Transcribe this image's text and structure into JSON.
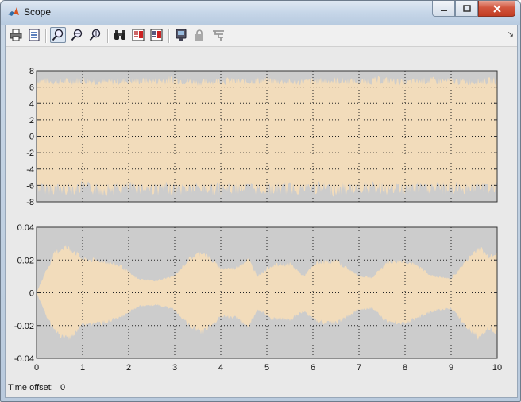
{
  "window": {
    "title": "Scope"
  },
  "toolbar": {
    "buttons": [
      {
        "icon": "print-icon"
      },
      {
        "icon": "parameters-icon"
      },
      {
        "icon": "zoom-icon"
      },
      {
        "icon": "zoom-x-icon"
      },
      {
        "icon": "zoom-y-icon"
      },
      {
        "icon": "autoscale-binoculars-icon"
      },
      {
        "icon": "save-axes-settings-icon"
      },
      {
        "icon": "restore-axes-settings-icon"
      },
      {
        "icon": "floating-scope-icon"
      },
      {
        "icon": "lock-icon"
      },
      {
        "icon": "signal-selection-icon"
      }
    ],
    "dock_symbol": "↘"
  },
  "colors": {
    "axes_bg": "#cccccc",
    "signal": "#f2dcbb",
    "grid": "#222222"
  },
  "chart_data": [
    {
      "type": "line",
      "xlim": [
        0,
        10
      ],
      "ylim": [
        -8,
        8
      ],
      "yticks": [
        "8",
        "6",
        "4",
        "2",
        "0",
        "-2",
        "-4",
        "-6",
        "-8"
      ],
      "grid": true,
      "envelope": {
        "x": [
          0,
          0.5,
          1,
          1.5,
          2,
          2.5,
          3,
          3.5,
          4,
          4.5,
          5,
          5.5,
          6,
          6.5,
          7,
          7.5,
          8,
          8.5,
          9,
          9.5,
          10
        ],
        "upper": [
          7.3,
          7.1,
          7.4,
          7.0,
          7.3,
          7.2,
          7.5,
          7.0,
          7.3,
          7.1,
          7.4,
          7.0,
          7.2,
          7.3,
          7.1,
          7.4,
          7.0,
          7.3,
          7.2,
          7.1,
          7.3
        ],
        "lower": [
          -7.0,
          -7.3,
          -7.1,
          -7.4,
          -7.0,
          -7.2,
          -7.3,
          -7.1,
          -7.4,
          -7.0,
          -7.3,
          -7.2,
          -7.1,
          -7.4,
          -7.0,
          -7.2,
          -7.3,
          -7.1,
          -7.2,
          -7.0,
          -7.1
        ],
        "dense_upper": 5.8,
        "dense_lower": -4.8
      }
    },
    {
      "type": "line",
      "xlim": [
        0,
        10
      ],
      "ylim": [
        -0.04,
        0.04
      ],
      "xticks": [
        "0",
        "1",
        "2",
        "3",
        "4",
        "5",
        "6",
        "7",
        "8",
        "9",
        "10"
      ],
      "yticks": [
        "0.04",
        "0.02",
        "0",
        "-0.02",
        "-0.04"
      ],
      "grid": true,
      "envelope": {
        "x": [
          0,
          0.2,
          0.4,
          0.6,
          0.8,
          1,
          1.4,
          1.8,
          2.2,
          2.6,
          3,
          3.3,
          3.6,
          4,
          4.3,
          4.6,
          4.8,
          5.1,
          5.5,
          5.8,
          6.1,
          6.5,
          7,
          7.3,
          7.6,
          8,
          8.3,
          8.6,
          9,
          9.3,
          9.6,
          9.8,
          10
        ],
        "upper": [
          0.0,
          0.014,
          0.026,
          0.03,
          0.028,
          0.022,
          0.021,
          0.018,
          0.009,
          0.008,
          0.011,
          0.022,
          0.027,
          0.016,
          0.016,
          0.022,
          0.011,
          0.018,
          0.019,
          0.011,
          0.02,
          0.021,
          0.011,
          0.01,
          0.02,
          0.021,
          0.017,
          0.011,
          0.009,
          0.02,
          0.03,
          0.024,
          0.027
        ],
        "lower": [
          0.0,
          -0.014,
          -0.026,
          -0.03,
          -0.028,
          -0.021,
          -0.02,
          -0.017,
          -0.009,
          -0.008,
          -0.011,
          -0.021,
          -0.026,
          -0.016,
          -0.016,
          -0.022,
          -0.011,
          -0.017,
          -0.018,
          -0.012,
          -0.019,
          -0.02,
          -0.011,
          -0.01,
          -0.019,
          -0.02,
          -0.016,
          -0.012,
          -0.01,
          -0.021,
          -0.03,
          -0.023,
          -0.026
        ]
      }
    }
  ],
  "status": {
    "label": "Time offset:",
    "value": "0"
  }
}
